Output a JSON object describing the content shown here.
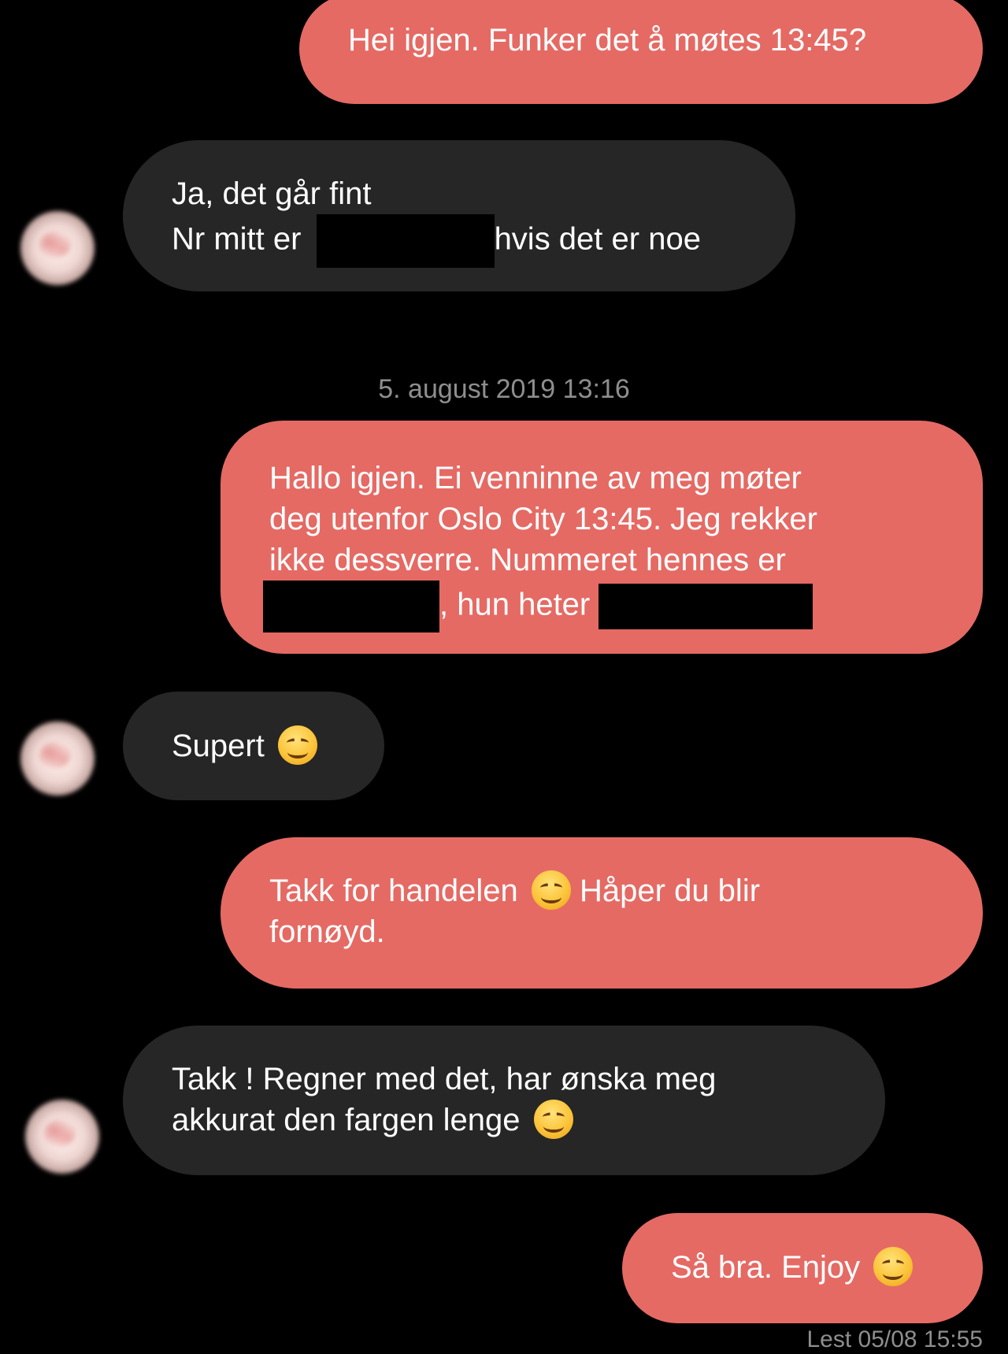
{
  "messages": [
    {
      "from": "me",
      "lines": [
        "Hei igjen. Funker det å møtes 13:45?"
      ]
    },
    {
      "from": "them",
      "lines": [
        "Ja, det går fint",
        "Nr mitt er",
        "hvis det er noe"
      ]
    },
    {
      "from": "me",
      "lines": [
        "Hallo igjen. Ei venninne av meg møter",
        "deg utenfor Oslo City 13:45. Jeg rekker",
        "ikke dessverre. Nummeret hennes er",
        ", hun heter"
      ]
    },
    {
      "from": "them",
      "lines": [
        "Supert"
      ]
    },
    {
      "from": "me",
      "lines": [
        "Takk for handelen",
        "Håper du blir",
        "fornøyd."
      ]
    },
    {
      "from": "them",
      "lines": [
        "Takk ! Regner med det, har ønska meg",
        "akkurat den fargen lenge"
      ]
    },
    {
      "from": "me",
      "lines": [
        "Så bra. Enjoy"
      ]
    }
  ],
  "timestamp": "5. august 2019 13:16",
  "read_receipt": "Lest 05/08 15:55",
  "colors": {
    "background": "#000000",
    "outgoing": "#e56a64",
    "incoming": "#262626"
  },
  "icons": {
    "emoji": "smiling-face-emoji",
    "avatar": "blurred-profile-photo"
  }
}
